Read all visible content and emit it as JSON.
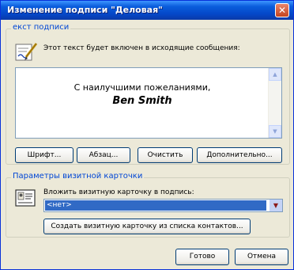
{
  "dialog": {
    "title": "Изменение подписи \"Деловая\"",
    "close_glyph": "✕"
  },
  "signature_text": {
    "group_label": "екст подписи",
    "hint": "Этот текст будет включен в исходящие сообщения:",
    "line1": "С наилучшими пожеланиями,",
    "line2": "Ben Smith",
    "buttons": {
      "font": "Шрифт...",
      "paragraph": "Абзац...",
      "clear": "Очистить",
      "advanced": "Дополнительно..."
    }
  },
  "vcard": {
    "group_label": "Параметры визитной карточки",
    "hint": "Вложить визитную карточку в подпись:",
    "selected": "<нет>",
    "create_button": "Создать визитную карточку из списка контактов..."
  },
  "footer": {
    "ok": "Готово",
    "cancel": "Отмена"
  },
  "icons": {
    "signature": "signature-pen-icon",
    "vcard": "vcard-icon",
    "close": "close-icon"
  },
  "colors": {
    "titlebar": "#0a5ddc",
    "dialog_bg": "#ece9d8",
    "group_label": "#0046d5",
    "selection": "#316ac5",
    "close_button": "#c4441f"
  }
}
